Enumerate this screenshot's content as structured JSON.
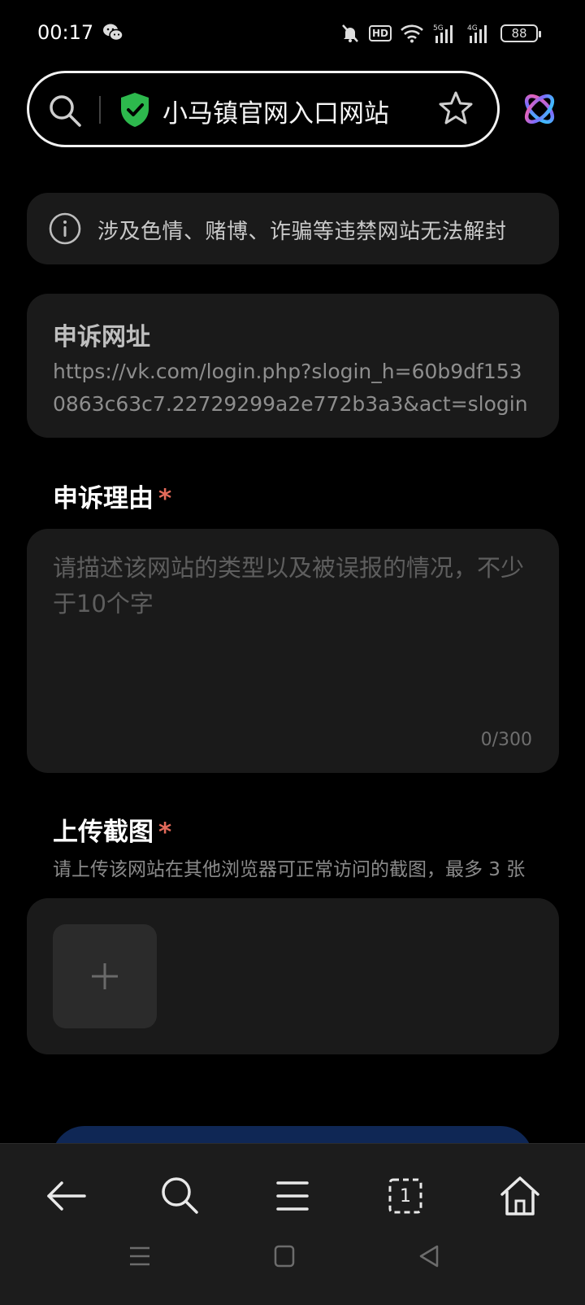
{
  "status_bar": {
    "time": "00:17",
    "battery": "88",
    "hd_label": "HD",
    "network_5g": "5G",
    "network_4g": "4G"
  },
  "search_bar": {
    "query": "小马镇官网入口网站"
  },
  "notice": {
    "text": "涉及色情、赌博、诈骗等违禁网站无法解封"
  },
  "url_section": {
    "title": "申诉网址",
    "value": "https://vk.com/login.php?slogin_h=60b9df1530863c63c7.22729299a2e772b3a3&act=slogin"
  },
  "reason_section": {
    "title": "申诉理由",
    "required_mark": "*",
    "placeholder": "请描述该网站的类型以及被误报的情况，不少于10个字",
    "counter": "0/300"
  },
  "upload_section": {
    "title": "上传截图",
    "required_mark": "*",
    "hint": "请上传该网站在其他浏览器可正常访问的截图，最多 3 张"
  },
  "toolbar": {
    "tab_count": "1"
  },
  "icons": {
    "status": [
      "wechat-icon",
      "mute-icon",
      "wifi-icon",
      "signal-icon"
    ],
    "toolbar": [
      "back-icon",
      "search-icon",
      "menu-icon",
      "tabs-icon",
      "home-icon"
    ],
    "navigation": [
      "recent-apps-icon",
      "home-square-icon",
      "back-triangle-icon"
    ]
  },
  "colors": {
    "background": "#000000",
    "card": "#1a1a1a",
    "required": "#e36a5a",
    "shield": "#2db84d",
    "submit": "#0f2755"
  }
}
